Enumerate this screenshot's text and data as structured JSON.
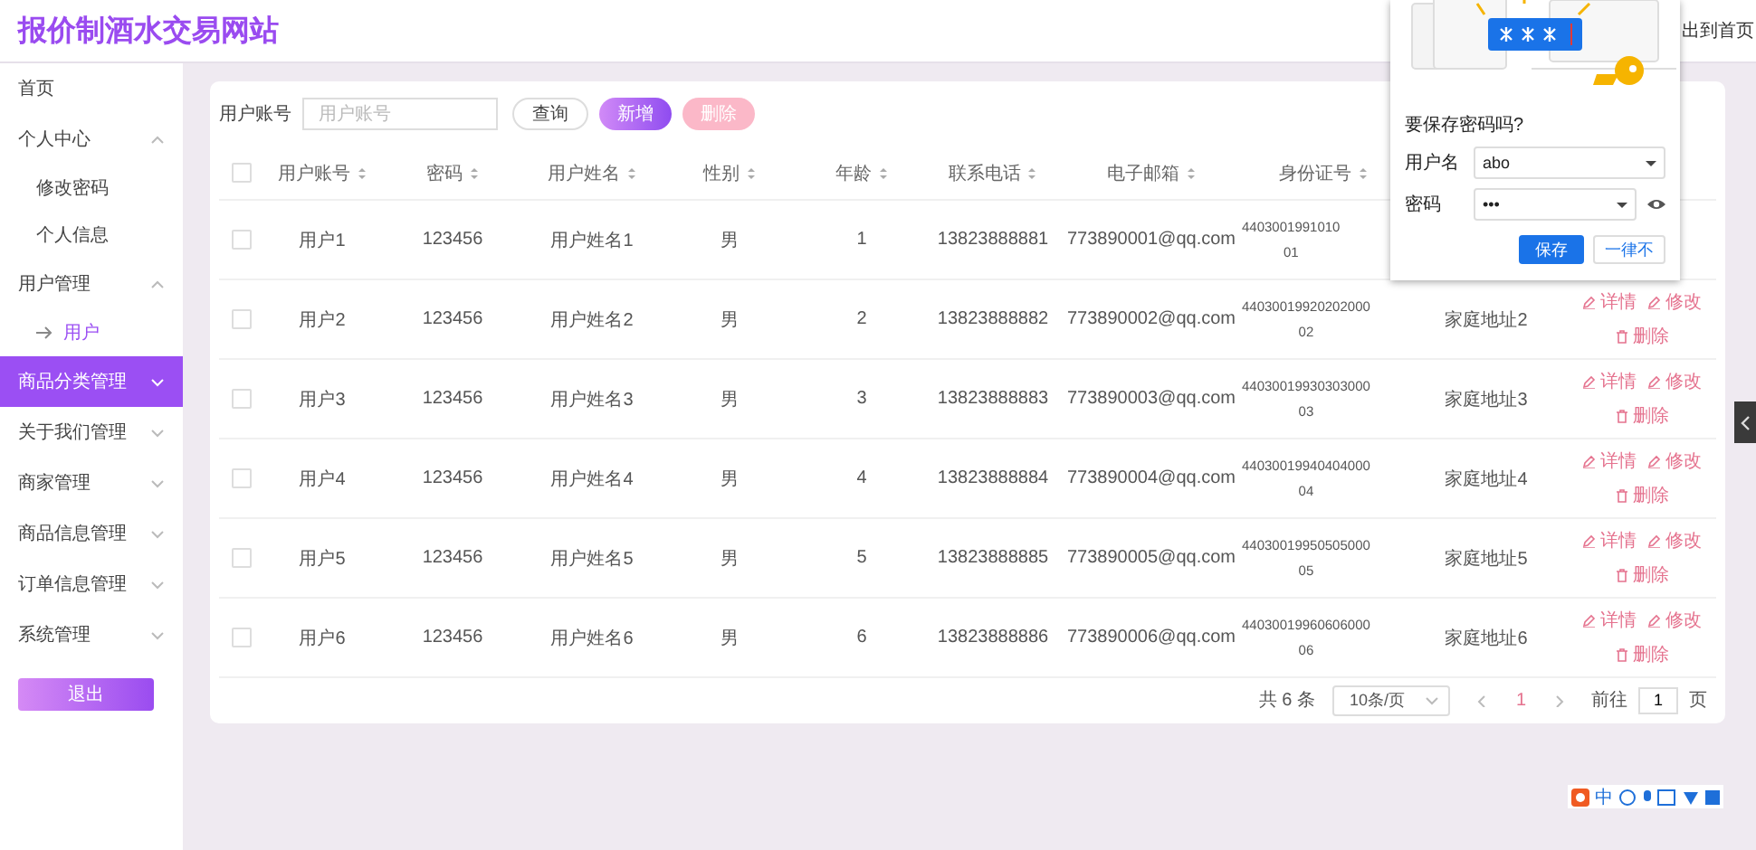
{
  "header": {
    "title": "报价制酒水交易网站",
    "link": "出到首页"
  },
  "sidebar": {
    "items": [
      {
        "label": "首页",
        "kind": "link",
        "selected": false
      },
      {
        "label": "个人中心",
        "kind": "group",
        "expanded": true,
        "selected": false,
        "children": [
          {
            "label": "修改密码",
            "selected": false
          },
          {
            "label": "个人信息",
            "selected": false
          }
        ]
      },
      {
        "label": "用户管理",
        "kind": "group",
        "expanded": true,
        "selected": false,
        "children": [
          {
            "label": "用户",
            "selected": true
          }
        ]
      },
      {
        "label": "商品分类管理",
        "kind": "group",
        "expanded": false,
        "selected": true
      },
      {
        "label": "关于我们管理",
        "kind": "group",
        "expanded": false,
        "selected": false
      },
      {
        "label": "商家管理",
        "kind": "group",
        "expanded": false,
        "selected": false
      },
      {
        "label": "商品信息管理",
        "kind": "group",
        "expanded": false,
        "selected": false
      },
      {
        "label": "订单信息管理",
        "kind": "group",
        "expanded": false,
        "selected": false
      },
      {
        "label": "系统管理",
        "kind": "group",
        "expanded": false,
        "selected": false
      }
    ],
    "logout": "退出"
  },
  "search": {
    "label": "用户账号",
    "placeholder": "用户账号"
  },
  "buttons": [
    {
      "label": "查询",
      "kind": "plain"
    },
    {
      "label": "新增",
      "kind": "primary"
    },
    {
      "label": "删除",
      "kind": "danger"
    }
  ],
  "table": {
    "select_all_checked": false,
    "columns": [
      "用户账号",
      "密码",
      "用户姓名",
      "性别",
      "年龄",
      "联系电话",
      "电子邮箱",
      "身份证号"
    ],
    "rows": [
      {
        "checked": false,
        "cells": [
          "用户1",
          "123456",
          "用户姓名1",
          "男",
          "1",
          "13823888881",
          "773890001@qq.com"
        ],
        "id_lines": [
          "4403001991010",
          "01"
        ]
      },
      {
        "checked": false,
        "cells": [
          "用户2",
          "123456",
          "用户姓名2",
          "男",
          "2",
          "13823888882",
          "773890002@qq.com"
        ],
        "id_lines": [
          "44030019920202000",
          "02"
        ],
        "address": "家庭地址2",
        "actions": [
          "详情",
          "修改",
          "删除"
        ]
      },
      {
        "checked": false,
        "cells": [
          "用户3",
          "123456",
          "用户姓名3",
          "男",
          "3",
          "13823888883",
          "773890003@qq.com"
        ],
        "id_lines": [
          "44030019930303000",
          "03"
        ],
        "address": "家庭地址3",
        "actions": [
          "详情",
          "修改",
          "删除"
        ]
      },
      {
        "checked": false,
        "cells": [
          "用户4",
          "123456",
          "用户姓名4",
          "男",
          "4",
          "13823888884",
          "773890004@qq.com"
        ],
        "id_lines": [
          "44030019940404000",
          "04"
        ],
        "address": "家庭地址4",
        "actions": [
          "详情",
          "修改",
          "删除"
        ]
      },
      {
        "checked": false,
        "cells": [
          "用户5",
          "123456",
          "用户姓名5",
          "男",
          "5",
          "13823888885",
          "773890005@qq.com"
        ],
        "id_lines": [
          "44030019950505000",
          "05"
        ],
        "address": "家庭地址5",
        "actions": [
          "详情",
          "修改",
          "删除"
        ]
      },
      {
        "checked": false,
        "cells": [
          "用户6",
          "123456",
          "用户姓名6",
          "男",
          "6",
          "13823888886",
          "773890006@qq.com"
        ],
        "id_lines": [
          "44030019960606000",
          "06"
        ],
        "address": "家庭地址6",
        "actions": [
          "详情",
          "修改",
          "删除"
        ]
      }
    ]
  },
  "pagination": {
    "total": "共 6 条",
    "page_size": "10条/页",
    "pages": [
      {
        "label": "1",
        "selected": true
      }
    ],
    "goto_label": "前往",
    "goto_value": "1",
    "goto_suffix": "页"
  },
  "password_popup": {
    "title": "要保存密码吗?",
    "username_label": "用户名",
    "username": "abo",
    "password_label": "密码",
    "password": "•••",
    "save": "保存",
    "never": "一律不"
  },
  "ime_toolbar": {
    "label": "中"
  }
}
